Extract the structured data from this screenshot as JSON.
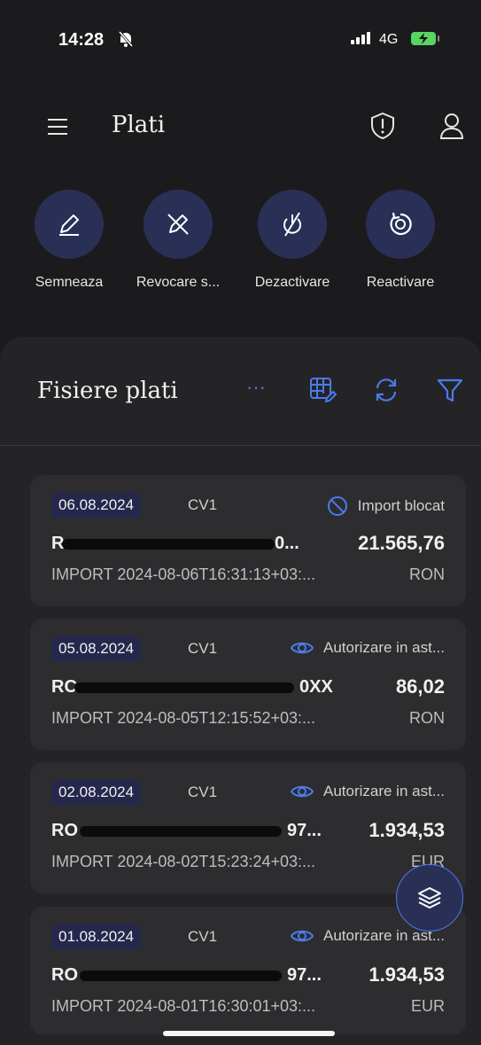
{
  "status_bar": {
    "time": "14:28",
    "network": "4G"
  },
  "header": {
    "title": "Plati"
  },
  "actions": [
    {
      "label": "Semneaza"
    },
    {
      "label": "Revocare s..."
    },
    {
      "label": "Dezactivare"
    },
    {
      "label": "Reactivare"
    }
  ],
  "panel": {
    "title": "Fisiere plati",
    "more": "···"
  },
  "cards": [
    {
      "date": "06.08.2024",
      "cv": "CV1",
      "status": "Import blocat",
      "ref_prefix": "R",
      "ref_suffix": "0...",
      "amount": "21.565,76",
      "description": "IMPORT 2024-08-06T16:31:13+03:...",
      "currency": "RON"
    },
    {
      "date": "05.08.2024",
      "cv": "CV1",
      "status": "Autorizare in ast...",
      "ref_prefix": "RC",
      "ref_suffix": "0XX",
      "amount": "86,02",
      "description": "IMPORT 2024-08-05T12:15:52+03:...",
      "currency": "RON"
    },
    {
      "date": "02.08.2024",
      "cv": "CV1",
      "status": "Autorizare in ast...",
      "ref_prefix": "RO",
      "ref_suffix": "97...",
      "amount": "1.934,53",
      "description": "IMPORT 2024-08-02T15:23:24+03:...",
      "currency": "EUR"
    },
    {
      "date": "01.08.2024",
      "cv": "CV1",
      "status": "Autorizare in ast...",
      "ref_prefix": "RO",
      "ref_suffix": "97...",
      "amount": "1.934,53",
      "description": "IMPORT 2024-08-01T16:30:01+03:...",
      "currency": "EUR"
    }
  ],
  "colors": {
    "accent": "#4a7bea",
    "button_bg": "#2a2f55",
    "badge_bg": "#26274d",
    "battery": "#57d462"
  }
}
